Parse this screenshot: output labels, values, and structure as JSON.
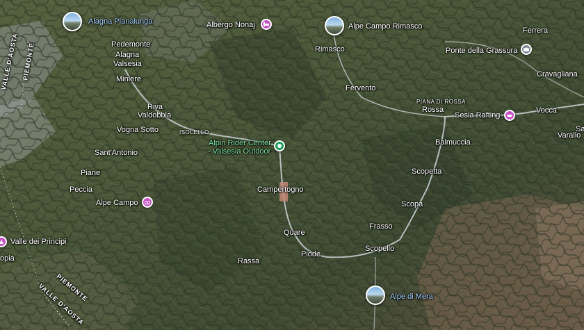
{
  "map": {
    "type": "satellite-terrain",
    "colors": {
      "recreation_pin": "#c653c4",
      "hotel_pin": "#c653c4",
      "attraction_pin": "#1e9e58",
      "landmark_pin": "#7c8896",
      "route_line": "#c9d3d6"
    }
  },
  "places": {
    "alagna_pianalunga": "Alagna Pianalunga",
    "albergo_nonaj": "Albergo Nonaj",
    "alpe_campo_rimasco": "Alpe Campo Rimasco",
    "ferrera": "Ferrera",
    "pedemonte": "Pedemonte",
    "alagna_valsesia_1": "Alagna",
    "alagna_valsesia_2": "Valsesia",
    "rimasco": "Rimasco",
    "ponte_della_grassura": "Ponte della Grassura",
    "cravagliana": "Cravagliana",
    "miniere": "Miniere",
    "fervento": "Fervento",
    "riva_valdobbia_1": "Riva",
    "riva_valdobbia_2": "Valdobbia",
    "piana_di_rossa": "PIANA DI ROSSA",
    "rossa": "Rossa",
    "sesia_rafting": "Sesia Rafting",
    "vocca": "Vocca",
    "vogna_sotto": "Vogna Sotto",
    "isolello": "ISOLELLO",
    "alpin_rider_1": "Alpin Rider Center",
    "alpin_rider_2": "- Valsesia Outdoor",
    "varallo": "Varallo",
    "sal": "Sal",
    "balmuccia": "Balmuccia",
    "santantonio": "Sant'Antonio",
    "piane": "Piane",
    "scopetta": "Scopetta",
    "campertogno": "Campertogno",
    "peccia": "Peccia",
    "alpe_campo": "Alpe Campo",
    "scopa": "Scopa",
    "fras_so": "Frasso",
    "quare": "Quare",
    "valle_dei_principi": "Valle dei Principi",
    "scopello": "Scopello",
    "piode": "Piode",
    "rassa": "Rassa",
    "opia": "opia",
    "alpe_di_mera": "Alpe di Mera"
  },
  "regions": {
    "valle_daosta_top": "VALLE D'AOSTA",
    "piemonte_top": "PIEMONTE",
    "piemonte_bottom": "PIEMONTE",
    "valle_daosta_bottom": "VALLE D'AOSTA"
  }
}
